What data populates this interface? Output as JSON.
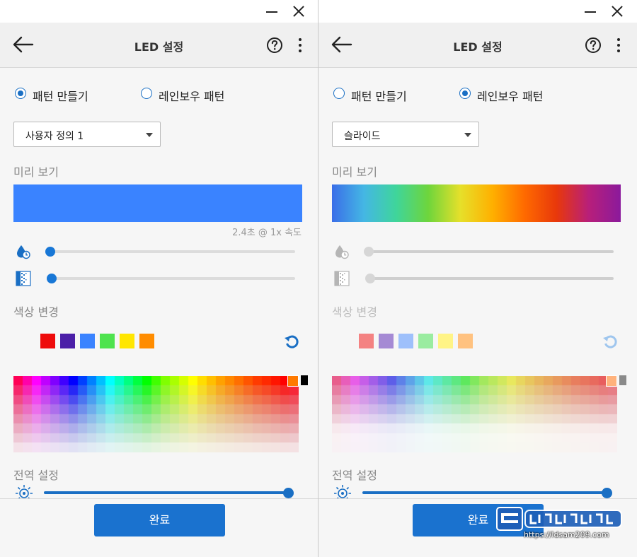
{
  "panels": [
    {
      "header": {
        "title": "LED 설정"
      },
      "pattern_options": [
        {
          "label": "패턴 만들기",
          "selected": true
        },
        {
          "label": "레인보우 패턴",
          "selected": false
        }
      ],
      "dropdown": {
        "value": "사용자 정의 1"
      },
      "preview": {
        "label": "미리 보기",
        "colors": [
          "#3a83ff"
        ],
        "speed_text": "2.4초 @ 1x 속도"
      },
      "sliders": [
        {
          "icon": "speed-drop-icon",
          "value": 0.0,
          "enabled": true
        },
        {
          "icon": "transition-icon",
          "value": 0.0,
          "enabled": true
        }
      ],
      "color_change": {
        "label": "색상 변경",
        "swatches": [
          "#ee0b0b",
          "#4b1fa8",
          "#3a83ff",
          "#4ee34e",
          "#ffe600",
          "#ff8c00"
        ],
        "enabled": true
      },
      "picker": {
        "selected_color": "#ff7a00",
        "secondary_color": "#000000",
        "enabled": true
      },
      "global": {
        "label": "전역 설정",
        "brightness": 1.0
      },
      "button": {
        "label": "완료"
      }
    },
    {
      "header": {
        "title": "LED 설정"
      },
      "pattern_options": [
        {
          "label": "패턴 만들기",
          "selected": false
        },
        {
          "label": "레인보우 패턴",
          "selected": true
        }
      ],
      "dropdown": {
        "value": "슬라이드"
      },
      "preview": {
        "label": "미리 보기",
        "colors": [
          "#3a6ee8",
          "#44b7e4",
          "#3fd59b",
          "#6ed53c",
          "#e6e02a",
          "#ffb000",
          "#ff6a00",
          "#e8380b",
          "#b81f7a",
          "#8b1a9c"
        ],
        "speed_text": ""
      },
      "sliders": [
        {
          "icon": "speed-drop-icon",
          "value": 0.0,
          "enabled": false
        },
        {
          "icon": "transition-icon",
          "value": 0.0,
          "enabled": false
        }
      ],
      "color_change": {
        "label": "색상 변경",
        "swatches": [
          "#f48282",
          "#a58ad4",
          "#9ec0fb",
          "#9aeca0",
          "#fff486",
          "#ffc280"
        ],
        "enabled": false
      },
      "picker": {
        "selected_color": "#ffb27c",
        "secondary_color": "#8a8a8a",
        "enabled": false
      },
      "global": {
        "label": "전역 설정",
        "brightness": 1.0
      },
      "button": {
        "label": "완료"
      }
    }
  ],
  "watermark": {
    "url": "https://ldsam209.com"
  },
  "colors": {
    "accent": "#1a72cf",
    "accent_dark": "#1877d6"
  }
}
